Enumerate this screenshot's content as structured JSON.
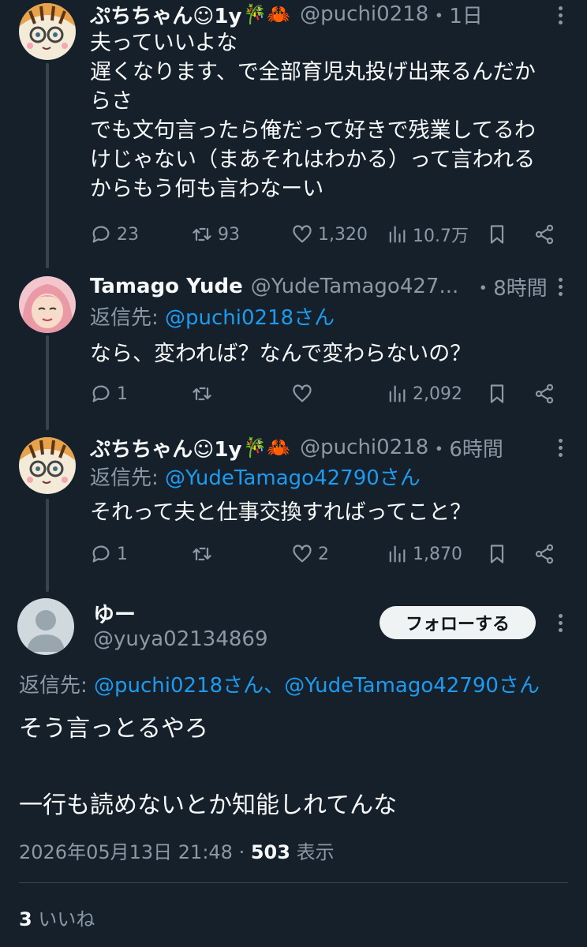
{
  "tweets": [
    {
      "name": "ぷちちゃん☺1y",
      "name_emojis": "🎋🦀",
      "handle": "@puchi0218",
      "time": "・1日",
      "body": [
        "夫っていいよな",
        "遅くなります、で全部育児丸投げ出来るんだか",
        "らさ",
        "でも文句言ったら俺だって好きで残業してるわ",
        "けじゃない（まあそれはわかる）って言われる",
        "からもう何も言わなーい"
      ],
      "stats": {
        "replies": "23",
        "retweets": "93",
        "likes": "1,320",
        "views": "10.7万"
      }
    },
    {
      "name": "Tamago Yude",
      "handle": "@YudeTamago427...",
      "time": "・8時間",
      "reply_label": "返信先: ",
      "reply_mention": "@puchi0218さん",
      "body": [
        "なら、変われば？なんで変わらないの？"
      ],
      "stats": {
        "replies": "1",
        "retweets": "",
        "likes": "",
        "views": "2,092"
      }
    },
    {
      "name": "ぷちちゃん☺1y",
      "name_emojis": "🎋🦀",
      "handle": "@puchi0218",
      "time": "・6時間",
      "reply_label": "返信先: ",
      "reply_mention": "@YudeTamago42790さん",
      "body": [
        "それって夫と仕事交換すればってこと？"
      ],
      "stats": {
        "replies": "1",
        "retweets": "",
        "likes": "2",
        "views": "1,870"
      }
    }
  ],
  "focus": {
    "name": "ゆー",
    "handle": "@yuya02134869",
    "follow_label": "フォローする",
    "reply_label": "返信先: ",
    "reply_mention_1": "@puchi0218さん",
    "reply_sep": "、",
    "reply_mention_2": "@YudeTamago42790さん",
    "line1": "そう言っとるやろ",
    "line2": "一行も読めないとか知能しれてんな",
    "timestamp": "2026年05月13日 21:48",
    "dot": " · ",
    "views_count": "503",
    "views_label": " 表示",
    "likes_count": "3",
    "likes_label": " いいね"
  },
  "colors": {
    "background": "#15202b",
    "text": "#f7f9f9",
    "secondary": "#8b98a5",
    "link": "#1d9bf0",
    "divider": "#38444d"
  }
}
